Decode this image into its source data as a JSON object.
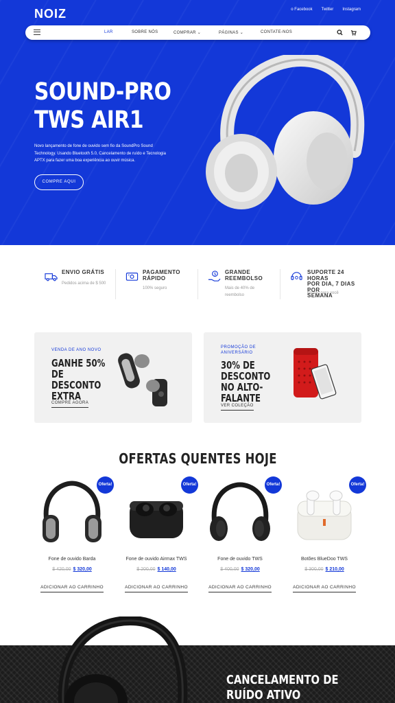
{
  "header": {
    "logo": "NOIZ",
    "social": [
      "o Facebook",
      "Twitter",
      "Instagram"
    ],
    "nav": [
      {
        "label": "LAR",
        "active": true
      },
      {
        "label": "SOBRE NÓS"
      },
      {
        "label": "COMPRAR",
        "dropdown": true
      },
      {
        "label": "PÁGINAS",
        "dropdown": true
      },
      {
        "label": "CONTATE-NOS"
      }
    ],
    "icons": [
      "menu-icon",
      "search-icon",
      "cart-icon"
    ]
  },
  "hero": {
    "title_line1": "SOUND-PRO",
    "title_line2": "TWS AIR1",
    "description": "Novo lançamento de fone de ouvido sem fio da SoundPro Sound Technology. Usando Bluetooth 5.0, Cancelamento de ruído e Tecnologia APTX para fazer uma boa experiência ao ouvir música.",
    "button": "COMPRE AQUI",
    "bg_color": "#1338d8"
  },
  "features": [
    {
      "title": "ENVIO GRÁTIS",
      "subtitle": "Pedidos acima de $ 500",
      "icon": "truck-icon"
    },
    {
      "title": "PAGAMENTO\nRÁPIDO",
      "subtitle": "100% seguro",
      "icon": "payment-icon"
    },
    {
      "title": "GRANDE\nREEMBOLSO",
      "subtitle": "Mais de 40% de reembolso",
      "icon": "refund-icon"
    },
    {
      "title": "SUPORTE 24 HORAS\nPOR DIA, 7 DIAS POR\nSEMANA",
      "subtitle": "Pronto para você",
      "icon": "support-icon"
    }
  ],
  "promos": [
    {
      "eyebrow": "VENDA DE ANO NOVO",
      "title": "GANHE 50% DE DESCONTO EXTRA",
      "link": "COMPRE AGORA"
    },
    {
      "eyebrow": "PROMOÇÃO DE ANIVERSÁRIO",
      "title": "30% DE DESCONTO NO ALTO-FALANTE",
      "link": "VER COLEÇÃO"
    }
  ],
  "deals": {
    "title": "OFERTAS QUENTES HOJE",
    "badge": "Oferta!",
    "add_to_cart": "ADICIONAR AO CARRINHO",
    "products": [
      {
        "name": "Fone de ouvido Barda",
        "old_price": "$ 420,00",
        "price": "$ 320,00"
      },
      {
        "name": "Fone de ouvido Airmax TWS",
        "old_price": "$ 200,00",
        "price": "$ 140,00"
      },
      {
        "name": "Fone de ouvido TWS",
        "old_price": "$ 400,00",
        "price": "$ 320,00"
      },
      {
        "name": "Botões BlueDoo TWS",
        "old_price": "$ 300,00",
        "price": "$ 210,00"
      }
    ]
  },
  "banner": {
    "title": "CANCELAMENTO DE RUÍDO ATIVO"
  }
}
